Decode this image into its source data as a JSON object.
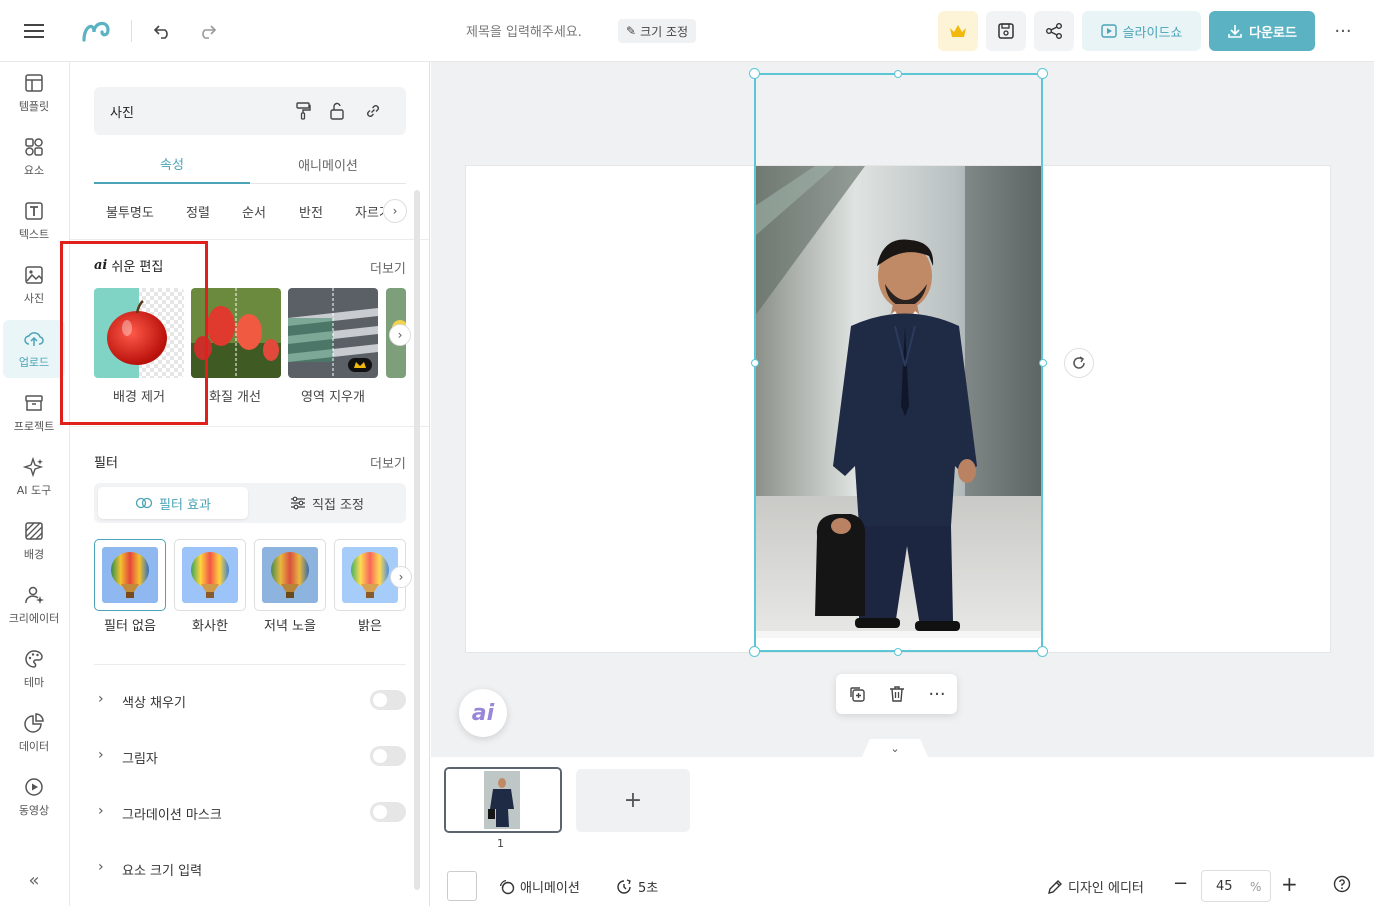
{
  "header": {
    "doc_title_placeholder": "제목을 입력해주세요.",
    "resize_label": "크기 조정",
    "slideshow_label": "슬라이드쇼",
    "download_label": "다운로드",
    "more_label": "···"
  },
  "rail": {
    "items": [
      {
        "label": "템플릿",
        "icon": "template-icon"
      },
      {
        "label": "요소",
        "icon": "elements-icon"
      },
      {
        "label": "텍스트",
        "icon": "text-icon"
      },
      {
        "label": "사진",
        "icon": "photo-icon"
      },
      {
        "label": "업로드",
        "icon": "upload-icon"
      },
      {
        "label": "프로젝트",
        "icon": "project-icon"
      },
      {
        "label": "AI 도구",
        "icon": "ai-tools-icon"
      },
      {
        "label": "배경",
        "icon": "background-icon"
      },
      {
        "label": "크리에이터",
        "icon": "creator-icon"
      },
      {
        "label": "테마",
        "icon": "theme-icon"
      },
      {
        "label": "데이터",
        "icon": "data-icon"
      },
      {
        "label": "동영상",
        "icon": "video-icon"
      }
    ],
    "active_index": 4,
    "collapse_label": "«"
  },
  "panel": {
    "header_label": "사진",
    "tabs": [
      "속성",
      "애니메이션"
    ],
    "active_tab": 0,
    "subtabs": [
      "불투명도",
      "정렬",
      "순서",
      "반전",
      "자르기"
    ],
    "easy_edit": {
      "title": "쉬운 편집",
      "ai_prefix": "ai",
      "more": "더보기",
      "cards": [
        "배경 제거",
        "화질 개선",
        "영역 지우개"
      ]
    },
    "filter": {
      "title": "필터",
      "more": "더보기",
      "modes": [
        "필터 효과",
        "직접 조정"
      ],
      "active_mode": 0,
      "presets": [
        "필터 없음",
        "화사한",
        "저녁 노을",
        "밝은"
      ]
    },
    "options": [
      {
        "label": "색상 채우기",
        "toggle": false
      },
      {
        "label": "그림자",
        "toggle": false
      },
      {
        "label": "그라데이션 마스크",
        "toggle": false
      },
      {
        "label": "요소 크기 입력",
        "toggle": null
      }
    ]
  },
  "canvas": {
    "ai_fab_label": "ai",
    "page_number": "1",
    "add_page_label": "+"
  },
  "bottom": {
    "animation_label": "애니메이션",
    "duration_label": "5초",
    "design_editor_label": "디자인 에디터",
    "zoom_value": "45",
    "zoom_unit": "%"
  },
  "colors": {
    "accent": "#5ab2c2",
    "selection": "#5dc6d6",
    "highlight": "#e0201c"
  }
}
